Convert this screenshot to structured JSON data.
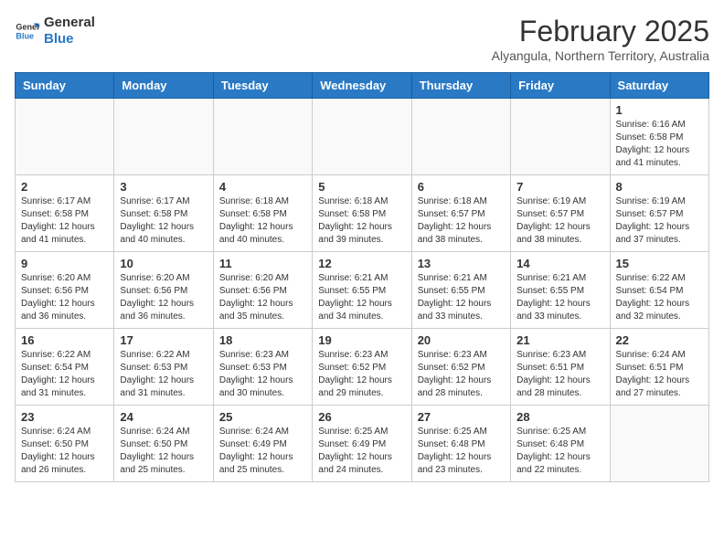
{
  "logo": {
    "line1": "General",
    "line2": "Blue"
  },
  "header": {
    "month": "February 2025",
    "location": "Alyangula, Northern Territory, Australia"
  },
  "weekdays": [
    "Sunday",
    "Monday",
    "Tuesday",
    "Wednesday",
    "Thursday",
    "Friday",
    "Saturday"
  ],
  "weeks": [
    [
      {
        "day": "",
        "info": ""
      },
      {
        "day": "",
        "info": ""
      },
      {
        "day": "",
        "info": ""
      },
      {
        "day": "",
        "info": ""
      },
      {
        "day": "",
        "info": ""
      },
      {
        "day": "",
        "info": ""
      },
      {
        "day": "1",
        "info": "Sunrise: 6:16 AM\nSunset: 6:58 PM\nDaylight: 12 hours and 41 minutes."
      }
    ],
    [
      {
        "day": "2",
        "info": "Sunrise: 6:17 AM\nSunset: 6:58 PM\nDaylight: 12 hours and 41 minutes."
      },
      {
        "day": "3",
        "info": "Sunrise: 6:17 AM\nSunset: 6:58 PM\nDaylight: 12 hours and 40 minutes."
      },
      {
        "day": "4",
        "info": "Sunrise: 6:18 AM\nSunset: 6:58 PM\nDaylight: 12 hours and 40 minutes."
      },
      {
        "day": "5",
        "info": "Sunrise: 6:18 AM\nSunset: 6:58 PM\nDaylight: 12 hours and 39 minutes."
      },
      {
        "day": "6",
        "info": "Sunrise: 6:18 AM\nSunset: 6:57 PM\nDaylight: 12 hours and 38 minutes."
      },
      {
        "day": "7",
        "info": "Sunrise: 6:19 AM\nSunset: 6:57 PM\nDaylight: 12 hours and 38 minutes."
      },
      {
        "day": "8",
        "info": "Sunrise: 6:19 AM\nSunset: 6:57 PM\nDaylight: 12 hours and 37 minutes."
      }
    ],
    [
      {
        "day": "9",
        "info": "Sunrise: 6:20 AM\nSunset: 6:56 PM\nDaylight: 12 hours and 36 minutes."
      },
      {
        "day": "10",
        "info": "Sunrise: 6:20 AM\nSunset: 6:56 PM\nDaylight: 12 hours and 36 minutes."
      },
      {
        "day": "11",
        "info": "Sunrise: 6:20 AM\nSunset: 6:56 PM\nDaylight: 12 hours and 35 minutes."
      },
      {
        "day": "12",
        "info": "Sunrise: 6:21 AM\nSunset: 6:55 PM\nDaylight: 12 hours and 34 minutes."
      },
      {
        "day": "13",
        "info": "Sunrise: 6:21 AM\nSunset: 6:55 PM\nDaylight: 12 hours and 33 minutes."
      },
      {
        "day": "14",
        "info": "Sunrise: 6:21 AM\nSunset: 6:55 PM\nDaylight: 12 hours and 33 minutes."
      },
      {
        "day": "15",
        "info": "Sunrise: 6:22 AM\nSunset: 6:54 PM\nDaylight: 12 hours and 32 minutes."
      }
    ],
    [
      {
        "day": "16",
        "info": "Sunrise: 6:22 AM\nSunset: 6:54 PM\nDaylight: 12 hours and 31 minutes."
      },
      {
        "day": "17",
        "info": "Sunrise: 6:22 AM\nSunset: 6:53 PM\nDaylight: 12 hours and 31 minutes."
      },
      {
        "day": "18",
        "info": "Sunrise: 6:23 AM\nSunset: 6:53 PM\nDaylight: 12 hours and 30 minutes."
      },
      {
        "day": "19",
        "info": "Sunrise: 6:23 AM\nSunset: 6:52 PM\nDaylight: 12 hours and 29 minutes."
      },
      {
        "day": "20",
        "info": "Sunrise: 6:23 AM\nSunset: 6:52 PM\nDaylight: 12 hours and 28 minutes."
      },
      {
        "day": "21",
        "info": "Sunrise: 6:23 AM\nSunset: 6:51 PM\nDaylight: 12 hours and 28 minutes."
      },
      {
        "day": "22",
        "info": "Sunrise: 6:24 AM\nSunset: 6:51 PM\nDaylight: 12 hours and 27 minutes."
      }
    ],
    [
      {
        "day": "23",
        "info": "Sunrise: 6:24 AM\nSunset: 6:50 PM\nDaylight: 12 hours and 26 minutes."
      },
      {
        "day": "24",
        "info": "Sunrise: 6:24 AM\nSunset: 6:50 PM\nDaylight: 12 hours and 25 minutes."
      },
      {
        "day": "25",
        "info": "Sunrise: 6:24 AM\nSunset: 6:49 PM\nDaylight: 12 hours and 25 minutes."
      },
      {
        "day": "26",
        "info": "Sunrise: 6:25 AM\nSunset: 6:49 PM\nDaylight: 12 hours and 24 minutes."
      },
      {
        "day": "27",
        "info": "Sunrise: 6:25 AM\nSunset: 6:48 PM\nDaylight: 12 hours and 23 minutes."
      },
      {
        "day": "28",
        "info": "Sunrise: 6:25 AM\nSunset: 6:48 PM\nDaylight: 12 hours and 22 minutes."
      },
      {
        "day": "",
        "info": ""
      }
    ]
  ]
}
